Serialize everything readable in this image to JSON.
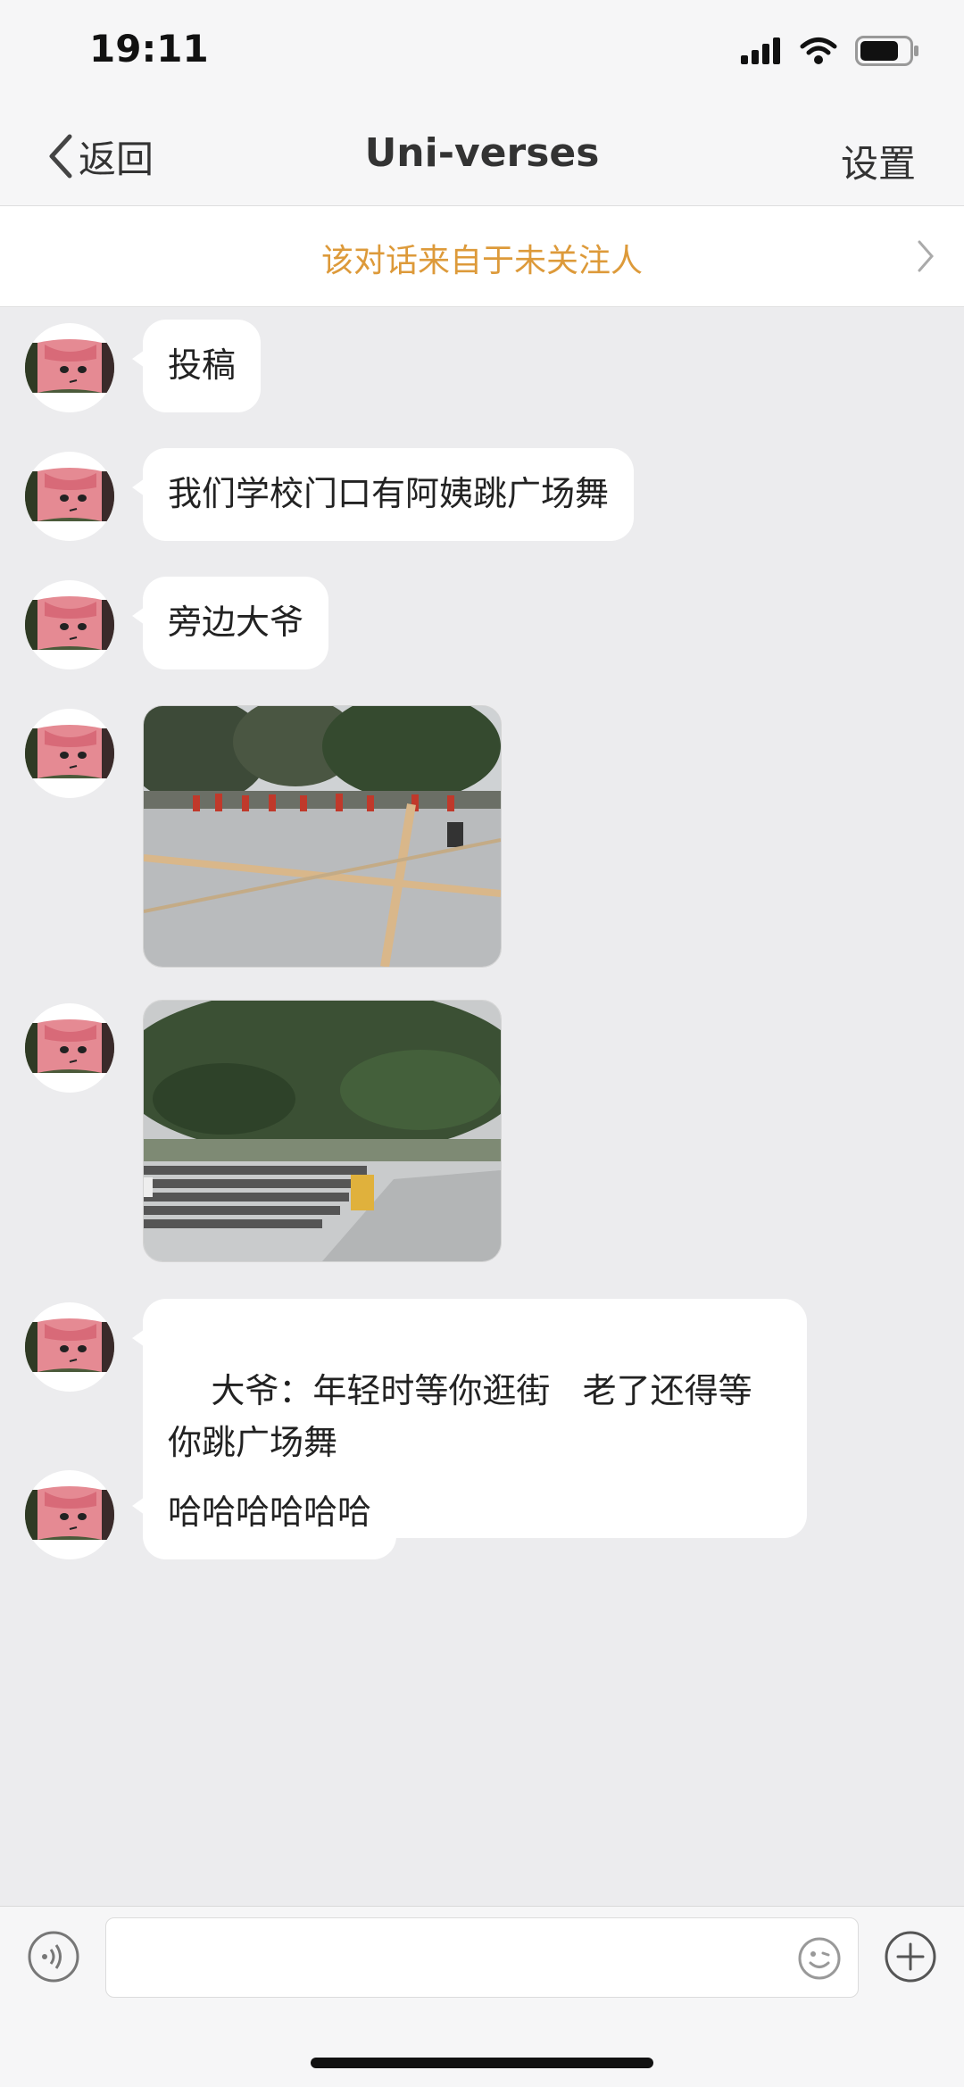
{
  "status_bar": {
    "time": "19:11",
    "battery_level": 0.8
  },
  "nav": {
    "back_label": "返回",
    "title": "Uni-verses",
    "settings_label": "设置"
  },
  "notice": {
    "text": "该对话来自于未关注人"
  },
  "messages": [
    {
      "type": "text",
      "text": "投稿"
    },
    {
      "type": "text",
      "text": "我们学校门口有阿姨跳广场舞"
    },
    {
      "type": "text",
      "text": "旁边大爷"
    },
    {
      "type": "image",
      "depicts": "plaza with people dancing under trees"
    },
    {
      "type": "image",
      "depicts": "trees and steps with a folding chair"
    },
    {
      "type": "text",
      "text": "大爷：年轻时等你逛街   老了还得等你跳广场舞"
    },
    {
      "type": "text",
      "text": "哈哈哈哈哈哈"
    }
  ],
  "input_bar": {
    "value": "",
    "voice_icon": "voice-icon",
    "emoji_icon": "emoji-icon",
    "plus_icon": "plus-icon"
  },
  "colors": {
    "notice_text": "#dd9a3a",
    "background": "#ececee",
    "bubble": "#ffffff"
  }
}
